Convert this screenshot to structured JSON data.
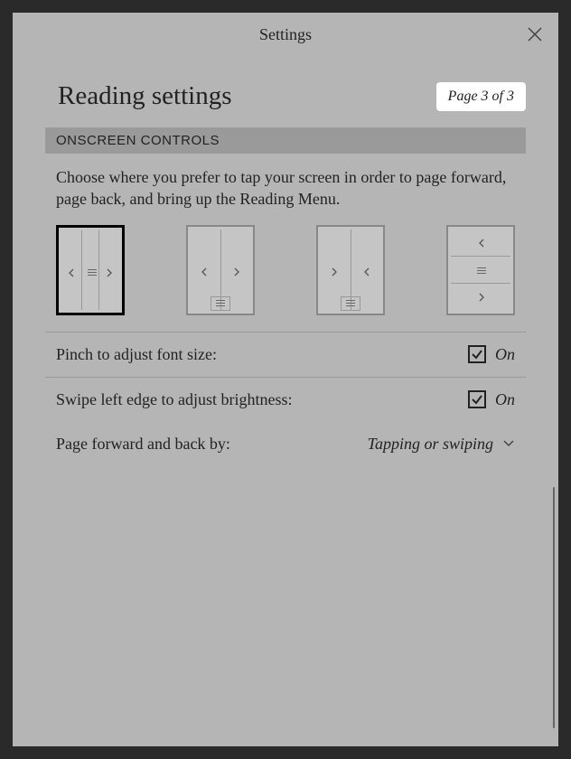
{
  "header": {
    "title": "Settings"
  },
  "page": {
    "title": "Reading settings",
    "badge": "Page 3 of 3"
  },
  "section": {
    "header": "ONSCREEN CONTROLS",
    "description": "Choose where you prefer to tap your screen in order to page forward, page back, and bring up the Reading Menu."
  },
  "settings": {
    "pinch": {
      "label": "Pinch to adjust font size:",
      "state": "On"
    },
    "swipe": {
      "label": "Swipe left edge to adjust brightness:",
      "state": "On"
    },
    "pageforward": {
      "label": "Page forward and back by:",
      "value": "Tapping or swiping"
    }
  }
}
